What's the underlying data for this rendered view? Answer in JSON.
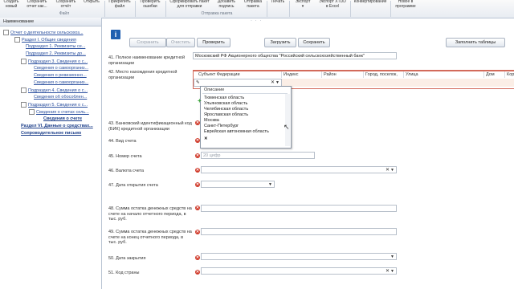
{
  "ribbon": {
    "buttons": [
      {
        "name": "ribbon-create-button",
        "label": "Создать\nновый"
      },
      {
        "name": "ribbon-save-as-button",
        "label": "Сохранить\nотчет как..."
      },
      {
        "name": "ribbon-save-report-button",
        "label": "Сохранить\nотчёт"
      },
      {
        "name": "ribbon-open-button",
        "label": "Открыть"
      },
      {
        "name": "ribbon-attach-file-button",
        "label": "Прикрепить\nфайл"
      },
      {
        "name": "ribbon-check-errors-button",
        "label": "Проверить\nошибки"
      },
      {
        "name": "ribbon-form-package-button",
        "label": "Сформировать пакет\nдля отправки"
      },
      {
        "name": "ribbon-add-signature-button",
        "label": "Добавить\nподпись"
      },
      {
        "name": "ribbon-send-package-button",
        "label": "Отправка\nпакета"
      },
      {
        "name": "ribbon-print-button",
        "label": "Печать"
      },
      {
        "name": "ribbon-export-button",
        "label": "Экспорт\n▾"
      },
      {
        "name": "ribbon-export-xtdd-button",
        "label": "Экспорт XTDD\nв Excel"
      },
      {
        "name": "ribbon-convert-button",
        "label": "Конвертирование"
      },
      {
        "name": "ribbon-new-in-program-button",
        "label": "Новое в\nпрограмме"
      }
    ],
    "groups": {
      "file": "Файл",
      "send_package": "Отправка пакета"
    }
  },
  "left_panel": {
    "header": "Наименование",
    "items": [
      "Отчет о деятельности сельскохоз...",
      "Раздел I. Общие сведения",
      "Подраздел 1. Реквизиты се...",
      "Подраздел 2. Реквизиты до...",
      "Подраздел 3. Сведения о с...",
      "Сведения о самоорганиз...",
      "Сведения о ревизионно...",
      "Сведения о самоорганиз...",
      "Подраздел 4. Сведения о с...",
      "Сведения об обособлен...",
      "Подраздел 5. Сведения о с...",
      "Сведения о счетах сель...",
      "Сведения о счете",
      "Раздел VI. Данные о средствах...",
      "Сопроводительное письмо"
    ]
  },
  "toolbar": {
    "save": "Сохранить",
    "clear": "Очистить",
    "check": "Проверить",
    "load": "Загрузить",
    "save2": "Сохранить",
    "fill_tables": "Заполнить таблицы"
  },
  "form": {
    "q41_label": "41. Полное наименование кредитной организации",
    "q41_value": "Московский РФ Акционерного общества \"Российский сельскохозяйственный банк\"",
    "q42_label": "42. Место нахождения кредитной организации",
    "grid_headers": [
      "Субъект Федерации",
      "Индекс",
      "Район",
      "Город, поселок,",
      "Улица",
      "Дом",
      "Корп"
    ],
    "q43_label": "43. Банковский идентификационный код (БИК) кредитной организации",
    "q44_label": "44. Вид счета",
    "q45_label": "45. Номер счета",
    "q45_placeholder": "20 цифр",
    "q46_label": "46. Валюта счета",
    "q47_label": "47. Дата открытия счета",
    "q48_label": "48. Сумма остатка денежных средств на счете на начало отчетного периода, в тыс. руб.",
    "q49_label": "49. Сумма остатка денежных средств на счете на конец отчетного периода, в тыс. руб.",
    "q50_label": "50. Дата закрытия",
    "q51_label": "51. Код страны"
  },
  "dropdown": {
    "header": "Описание",
    "options": [
      "Тюменская область",
      "Ульяновская область",
      "Челябинская область",
      "Ярославская область",
      "Москва",
      "Санкт-Петербург",
      "Еврейская автономная область"
    ],
    "clear_label": "✕"
  }
}
